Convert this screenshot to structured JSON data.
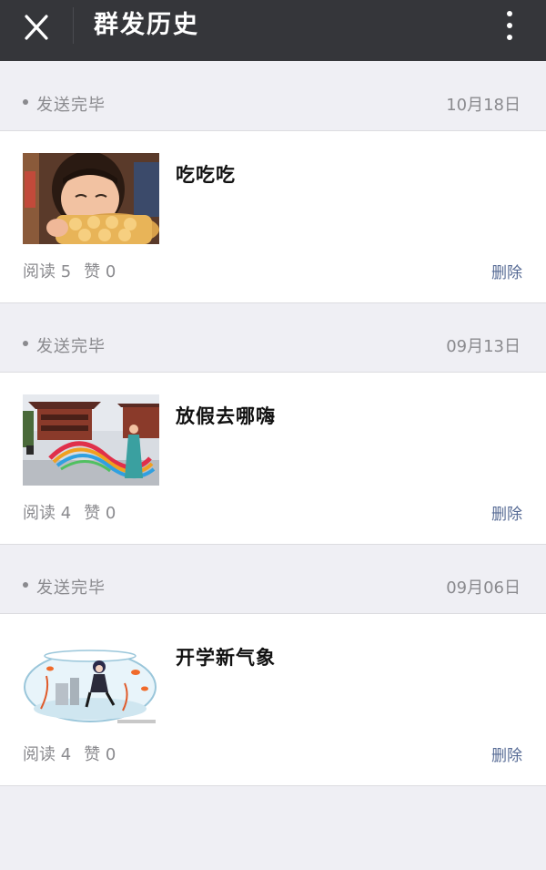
{
  "header": {
    "title": "群发历史",
    "close_icon": "close-icon",
    "more_icon": "more-vertical-icon"
  },
  "colors": {
    "topbar": "#35363a",
    "background": "#efeff4",
    "link": "#576b95",
    "muted": "#8a8a8e"
  },
  "items": [
    {
      "status": "发送完毕",
      "date": "10月18日",
      "title": "吃吃吃",
      "thumbnail": "child-eating-bread-image",
      "reads_label": "阅读 5",
      "likes_label": "赞 0",
      "delete_label": "删除"
    },
    {
      "status": "发送完毕",
      "date": "09月13日",
      "title": "放假去哪嗨",
      "thumbnail": "temple-ribbon-dancer-image",
      "reads_label": "阅读 4",
      "likes_label": "赞 0",
      "delete_label": "删除"
    },
    {
      "status": "发送完毕",
      "date": "09月06日",
      "title": "开学新气象",
      "thumbnail": "anime-fishbowl-image",
      "reads_label": "阅读 4",
      "likes_label": "赞 0",
      "delete_label": "删除"
    }
  ]
}
